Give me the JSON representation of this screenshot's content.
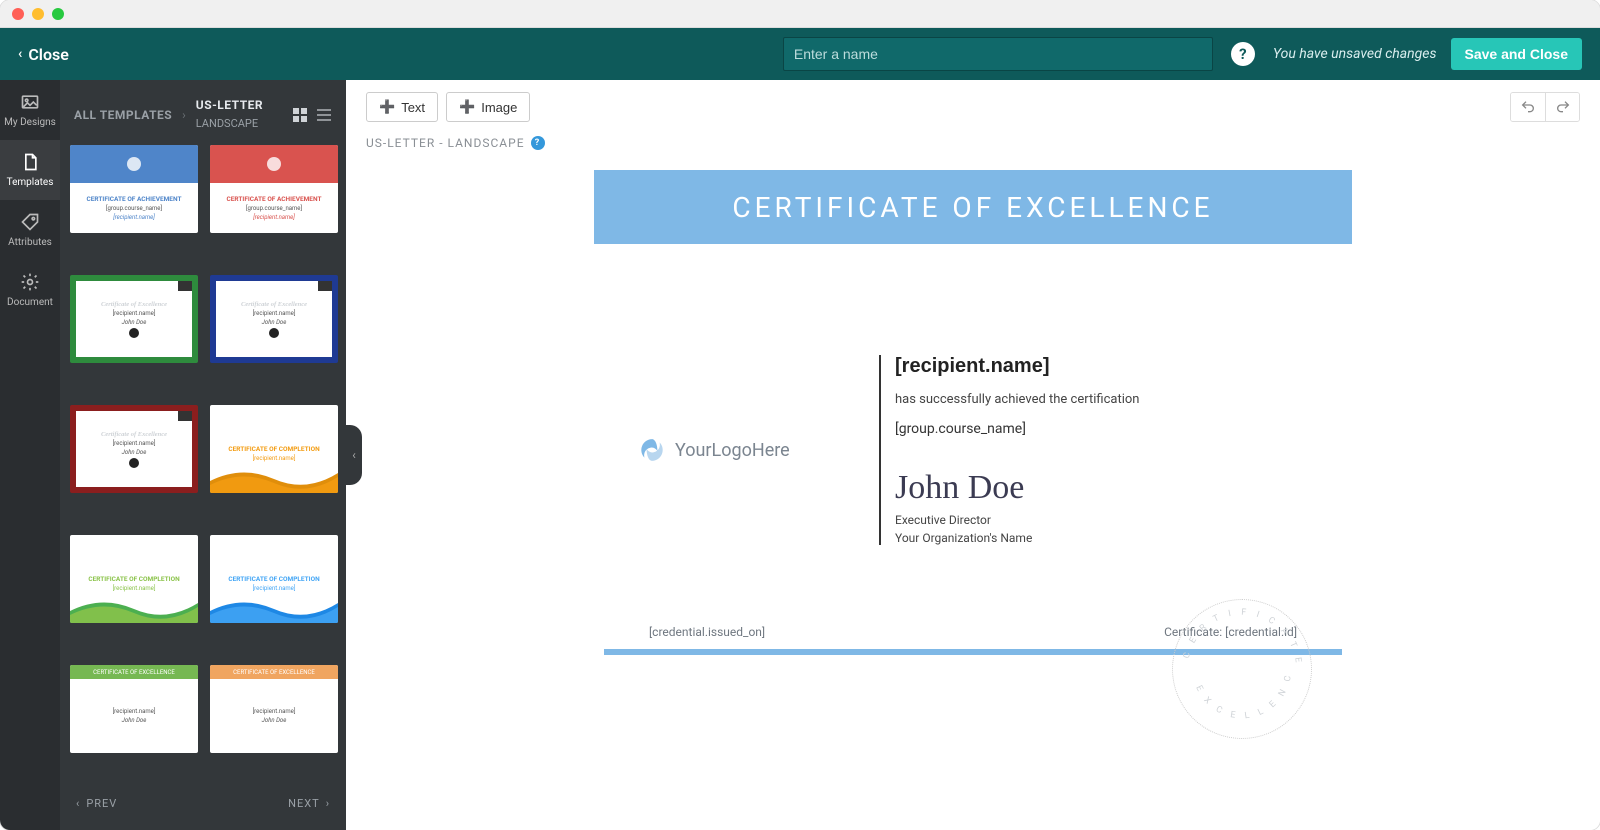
{
  "titlebar": {
    "close": true
  },
  "topbar": {
    "close_label": "Close",
    "name_placeholder": "Enter a name",
    "help": "?",
    "unsaved_label": "You have unsaved changes",
    "save_label": "Save and Close"
  },
  "nav": [
    {
      "id": "my-designs",
      "label": "My Designs"
    },
    {
      "id": "templates",
      "label": "Templates"
    },
    {
      "id": "attributes",
      "label": "Attributes"
    },
    {
      "id": "document",
      "label": "Document"
    }
  ],
  "panel": {
    "crumb_root": "ALL TEMPLATES",
    "crumb_leaf_line1": "US-LETTER",
    "crumb_leaf_line2": "LANDSCAPE",
    "prev_label": "PREV",
    "next_label": "NEXT"
  },
  "thumbs": [
    {
      "style": "banner",
      "color": "#4f85c9",
      "title": "CERTIFICATE OF ACHIEVEMENT",
      "sub": "[group.course_name]",
      "foot": "[recipient.name]"
    },
    {
      "style": "banner",
      "color": "#d9534f",
      "title": "CERTIFICATE OF ACHIEVEMENT",
      "sub": "[group.course_name]",
      "foot": "[recipient.name]"
    },
    {
      "style": "bordered",
      "color": "#2e8b3d",
      "title": "Certificate of Excellence",
      "sub": "[recipient.name]"
    },
    {
      "style": "bordered",
      "color": "#1f3a93",
      "title": "Certificate of Excellence",
      "sub": "[recipient.name]"
    },
    {
      "style": "bordered",
      "color": "#8b1e1e",
      "title": "Certificate of Excellence",
      "sub": "[recipient.name]"
    },
    {
      "style": "wave",
      "c1": "#f39c12",
      "c2": "#e08e0b",
      "title": "CERTIFICATE OF COMPLETION",
      "sub": "[recipient.name]"
    },
    {
      "style": "wave",
      "c1": "#8bc34a",
      "c2": "#4caf50",
      "title": "CERTIFICATE OF COMPLETION",
      "sub": "[recipient.name]"
    },
    {
      "style": "wave",
      "c1": "#42a5f5",
      "c2": "#1e88e5",
      "title": "CERTIFICATE OF COMPLETION",
      "sub": "[recipient.name]"
    },
    {
      "style": "strip",
      "color": "#76b852",
      "title": "CERTIFICATE OF EXCELLENCE",
      "sub": "[recipient.name]"
    },
    {
      "style": "strip",
      "color": "#f0a560",
      "title": "CERTIFICATE OF EXCELLENCE",
      "sub": "[recipient.name]"
    }
  ],
  "toolbar": {
    "text_label": "Text",
    "image_label": "Image",
    "format_label": "US-LETTER - LANDSCAPE"
  },
  "certificate": {
    "banner": "CERTIFICATE OF EXCELLENCE",
    "logo_text": "YourLogoHere",
    "recipient": "[recipient.name]",
    "achieved": "has successfully achieved the certification",
    "course": "[group.course_name]",
    "signature": "John Doe",
    "role": "Executive Director",
    "organization": "Your Organization's Name",
    "issued_on": "[credential.issued_on]",
    "cert_label": "Certificate:",
    "cert_id": "[credential.id]",
    "seal_upper": "C E R T I F I C A T E   O F",
    "seal_lower": "E X C E L L E N C E"
  },
  "colors": {
    "teal": "#0e5a5a",
    "accent": "#27c6b7",
    "banner": "#7fb8e6"
  }
}
